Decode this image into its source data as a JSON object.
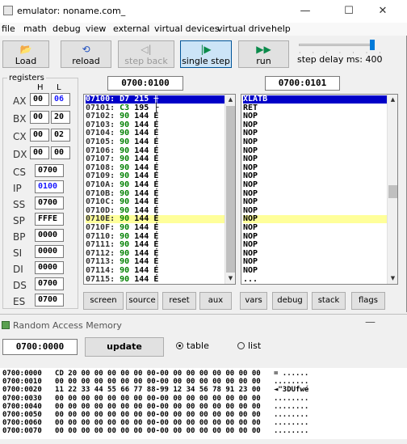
{
  "window": {
    "title": "emulator: noname.com_",
    "controls": [
      "—",
      "☐",
      "✕"
    ]
  },
  "menu": [
    "file",
    "math",
    "debug",
    "view",
    "external",
    "virtual devices",
    "virtual drive",
    "help"
  ],
  "toolbar": {
    "load": "Load",
    "reload": "reload",
    "step_back": "step back",
    "single_step": "single step",
    "run": "run",
    "step_delay": "step delay ms: 400"
  },
  "registers": {
    "legend": "registers",
    "h_label": "H",
    "l_label": "L",
    "split": [
      {
        "name": "AX",
        "h": "00",
        "l": "06"
      },
      {
        "name": "BX",
        "h": "00",
        "l": "20"
      },
      {
        "name": "CX",
        "h": "00",
        "l": "02"
      },
      {
        "name": "DX",
        "h": "00",
        "l": "00"
      }
    ],
    "full": [
      {
        "name": "CS",
        "value": "0700"
      },
      {
        "name": "IP",
        "value": "0100"
      },
      {
        "name": "SS",
        "value": "0700"
      },
      {
        "name": "SP",
        "value": "FFFE"
      },
      {
        "name": "BP",
        "value": "0000"
      },
      {
        "name": "SI",
        "value": "0000"
      },
      {
        "name": "DI",
        "value": "0000"
      },
      {
        "name": "DS",
        "value": "0700"
      },
      {
        "name": "ES",
        "value": "0700"
      }
    ]
  },
  "memory_view": {
    "address": "0700:0100",
    "lines": [
      {
        "addr": "07100:",
        "hex": "D7",
        "dec": "215",
        "chr": "╫"
      },
      {
        "addr": "07101:",
        "hex": "C3",
        "dec": "195",
        "chr": "├"
      },
      {
        "addr": "07102:",
        "hex": "90",
        "dec": "144",
        "chr": "É"
      },
      {
        "addr": "07103:",
        "hex": "90",
        "dec": "144",
        "chr": "É"
      },
      {
        "addr": "07104:",
        "hex": "90",
        "dec": "144",
        "chr": "É"
      },
      {
        "addr": "07105:",
        "hex": "90",
        "dec": "144",
        "chr": "É"
      },
      {
        "addr": "07106:",
        "hex": "90",
        "dec": "144",
        "chr": "É"
      },
      {
        "addr": "07107:",
        "hex": "90",
        "dec": "144",
        "chr": "É"
      },
      {
        "addr": "07108:",
        "hex": "90",
        "dec": "144",
        "chr": "É"
      },
      {
        "addr": "07109:",
        "hex": "90",
        "dec": "144",
        "chr": "É"
      },
      {
        "addr": "0710A:",
        "hex": "90",
        "dec": "144",
        "chr": "É"
      },
      {
        "addr": "0710B:",
        "hex": "90",
        "dec": "144",
        "chr": "É"
      },
      {
        "addr": "0710C:",
        "hex": "90",
        "dec": "144",
        "chr": "É"
      },
      {
        "addr": "0710D:",
        "hex": "90",
        "dec": "144",
        "chr": "É"
      },
      {
        "addr": "0710E:",
        "hex": "90",
        "dec": "144",
        "chr": "É"
      },
      {
        "addr": "0710F:",
        "hex": "90",
        "dec": "144",
        "chr": "É"
      },
      {
        "addr": "07110:",
        "hex": "90",
        "dec": "144",
        "chr": "É"
      },
      {
        "addr": "07111:",
        "hex": "90",
        "dec": "144",
        "chr": "É"
      },
      {
        "addr": "07112:",
        "hex": "90",
        "dec": "144",
        "chr": "É"
      },
      {
        "addr": "07113:",
        "hex": "90",
        "dec": "144",
        "chr": "É"
      },
      {
        "addr": "07114:",
        "hex": "90",
        "dec": "144",
        "chr": "É"
      },
      {
        "addr": "07115:",
        "hex": "90",
        "dec": "144",
        "chr": "É"
      }
    ]
  },
  "disasm_view": {
    "address": "0700:0101",
    "lines": [
      "XLATB",
      "RET",
      "NOP",
      "NOP",
      "NOP",
      "NOP",
      "NOP",
      "NOP",
      "NOP",
      "NOP",
      "NOP",
      "NOP",
      "NOP",
      "NOP",
      "NOP",
      "NOP",
      "NOP",
      "NOP",
      "NOP",
      "NOP",
      "NOP",
      "..."
    ]
  },
  "bottom_buttons": [
    "screen",
    "source",
    "reset",
    "aux",
    "vars",
    "debug",
    "stack",
    "flags"
  ],
  "ram": {
    "title": "Random Access Memory",
    "minimize": "—",
    "address": "0700:0000",
    "update": "update",
    "table_label": "table",
    "list_label": "list",
    "rows": [
      "0700:0000   CD 20 00 00 00 00 00 00-00 00 00 00 00 00 00 00   = ......",
      "0700:0010   00 00 00 00 00 00 00 00-00 00 00 00 00 00 00 00   ........",
      "0700:0020   11 22 33 44 55 66 77 88-99 12 34 56 78 91 23 00   ◄\"3DUfwé",
      "0700:0030   00 00 00 00 00 00 00 00-00 00 00 00 00 00 00 00   ........",
      "0700:0040   00 00 00 00 00 00 00 00-00 00 00 00 00 00 00 00   ........",
      "0700:0050   00 00 00 00 00 00 00 00-00 00 00 00 00 00 00 00   ........",
      "0700:0060   00 00 00 00 00 00 00 00-00 00 00 00 00 00 00 00   ........",
      "0700:0070   00 00 00 00 00 00 00 00-00 00 00 00 00 00 00 00   ........"
    ]
  },
  "colors": {
    "selection": "#0000c8",
    "highlight": "#ffff9a",
    "hex_text": "#008000",
    "accent": "#007ad9"
  }
}
